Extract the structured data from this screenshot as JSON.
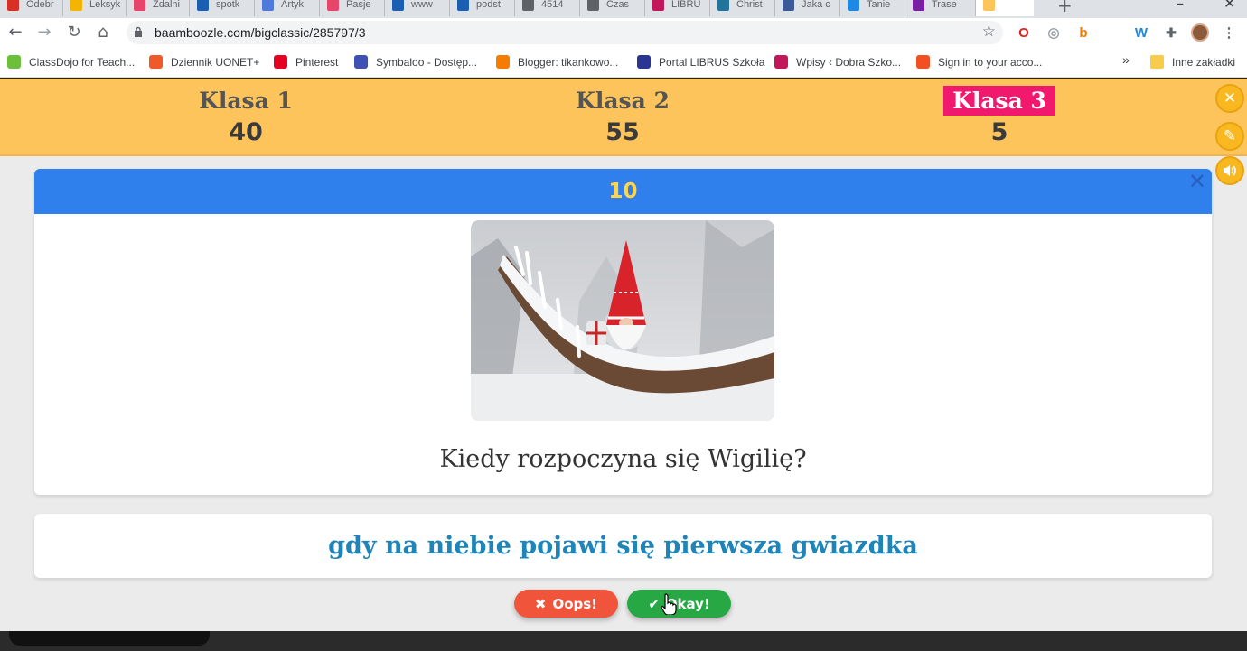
{
  "browser": {
    "tabs": [
      {
        "label": "Odebr",
        "color": "#d93025"
      },
      {
        "label": "Leksyk",
        "color": "#f4b400"
      },
      {
        "label": "Zdalni",
        "color": "#e8456b"
      },
      {
        "label": "spotk",
        "color": "#1a5fb4"
      },
      {
        "label": "Artyk",
        "color": "#4e7ad9"
      },
      {
        "label": "Pasje",
        "color": "#e8456b"
      },
      {
        "label": "www",
        "color": "#1a5fb4"
      },
      {
        "label": "podst",
        "color": "#1a5fb4"
      },
      {
        "label": "4514",
        "color": "#5f6368"
      },
      {
        "label": "Czas",
        "color": "#5f6368"
      },
      {
        "label": "LIBRU",
        "color": "#c2185b"
      },
      {
        "label": "Christ",
        "color": "#21759b"
      },
      {
        "label": "Jaka c",
        "color": "#3b5998"
      },
      {
        "label": "Tanie",
        "color": "#1e88e5"
      },
      {
        "label": "Trase",
        "color": "#7b1fa2"
      },
      {
        "label": "",
        "color": "#fec45c"
      }
    ],
    "new_tab": "+",
    "url": "baamboozle.com/bigclassic/285797/3",
    "bookmarks": [
      {
        "label": "ClassDojo for Teach...",
        "color": "#6bbf3a"
      },
      {
        "label": "Dziennik UONET+",
        "color": "#f05a28"
      },
      {
        "label": "Pinterest",
        "color": "#e60023"
      },
      {
        "label": "Symbaloo - Dostęp...",
        "color": "#3f51b5"
      },
      {
        "label": "Blogger: tikankowo...",
        "color": "#f57c00"
      },
      {
        "label": "Portal LIBRUS Szkoła",
        "color": "#283593"
      },
      {
        "label": "Wpisy ‹ Dobra Szko...",
        "color": "#c2185b"
      },
      {
        "label": "Sign in to your acco...",
        "color": "#f25022"
      }
    ],
    "overflow": "»",
    "other_bookmarks": "Inne zakładki"
  },
  "scoreboard": {
    "teams": [
      {
        "name": "Klasa 1",
        "score": "40"
      },
      {
        "name": "Klasa 2",
        "score": "55"
      },
      {
        "name": "Klasa 3",
        "score": "5"
      }
    ],
    "active_team": "Klasa 3"
  },
  "question": {
    "points": "10",
    "close": "✕",
    "image_alt": "gnome-in-snowy-tree",
    "text": "Kiedy rozpoczyna się Wigilię?"
  },
  "answer": {
    "text": "gdy na niebie pojawi się pierwsza gwiazdka"
  },
  "actions": {
    "oops": "Oops!",
    "okay": "Okay!"
  },
  "side_buttons": [
    "close-icon",
    "pencil-icon",
    "speaker-icon"
  ],
  "colors": {
    "scorebar": "#fec45c",
    "active_team": "#f1196d",
    "question_header": "#2f7fed",
    "points": "#ffd44d",
    "answer_text": "#1f84b8",
    "oops": "#f0543a",
    "okay": "#27a844"
  }
}
